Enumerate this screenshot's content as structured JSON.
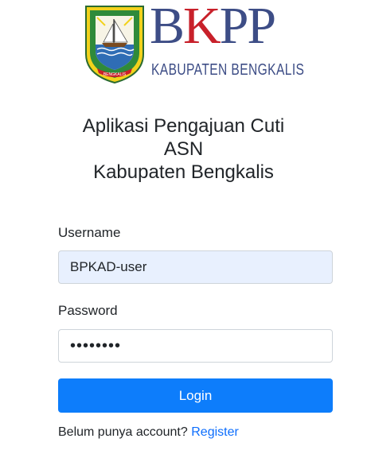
{
  "logo": {
    "wordmark_b": "B",
    "wordmark_k": "K",
    "wordmark_pp": "PP",
    "subtitle": "KABUPATEN BENGKALIS",
    "emblem_icon": "bengkalis-regency-emblem-icon",
    "colors": {
      "wordmark": "#3d4d86",
      "accent_k": "#c8202a",
      "emblem_green": "#2f8a3a",
      "emblem_yellow": "#f2d21b"
    }
  },
  "title": {
    "line1": "Aplikasi Pengajuan Cuti",
    "line2": "ASN",
    "line3": "Kabupaten Bengkalis"
  },
  "form": {
    "username_label": "Username",
    "username_value": "BPKAD-user",
    "password_label": "Password",
    "password_value": "12345678",
    "login_label": "Login",
    "no_account_text": "Belum punya account?",
    "register_link": "Register"
  },
  "theme": {
    "primary": "#0d7dfb",
    "autofill_bg": "#e8f0fe",
    "border": "#ced4da",
    "link": "#0d6efd"
  }
}
